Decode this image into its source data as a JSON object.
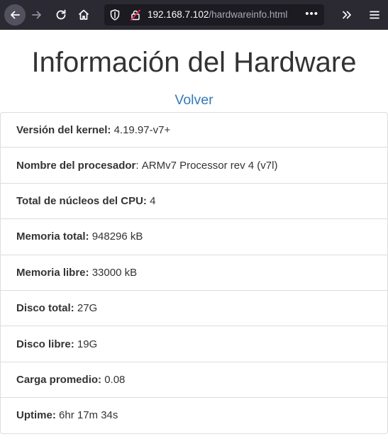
{
  "browser": {
    "url_host": "192.168.7.102",
    "url_path": "/hardwareinfo.html",
    "icons": [
      "back-icon",
      "forward-icon",
      "reload-icon",
      "home-icon",
      "shield-icon",
      "insecure-lock-icon",
      "more-icon",
      "overflow-icon",
      "menu-icon"
    ],
    "colors": {
      "toolbar": "#2b2a33",
      "urlbar": "#1c1b22",
      "insecure": "#e22850"
    }
  },
  "page": {
    "title": "Información del Hardware",
    "back_link": "Volver",
    "link_color": "#337ab7",
    "items": [
      {
        "label": "Versión del kernel:",
        "sep": " ",
        "value": "4.19.97-v7+"
      },
      {
        "label": "Nombre del procesador",
        "sep": ": ",
        "value": "ARMv7 Processor rev 4 (v7l)"
      },
      {
        "label": "Total de núcleos del CPU:",
        "sep": " ",
        "value": "4"
      },
      {
        "label": "Memoria total:",
        "sep": " ",
        "value": "948296 kB"
      },
      {
        "label": "Memoria libre:",
        "sep": " ",
        "value": "33000 kB"
      },
      {
        "label": "Disco total:",
        "sep": " ",
        "value": "27G"
      },
      {
        "label": "Disco libre:",
        "sep": " ",
        "value": "19G"
      },
      {
        "label": "Carga promedio:",
        "sep": " ",
        "value": "0.08"
      },
      {
        "label": "Uptime:",
        "sep": " ",
        "value": "6hr 17m 34s"
      }
    ]
  }
}
